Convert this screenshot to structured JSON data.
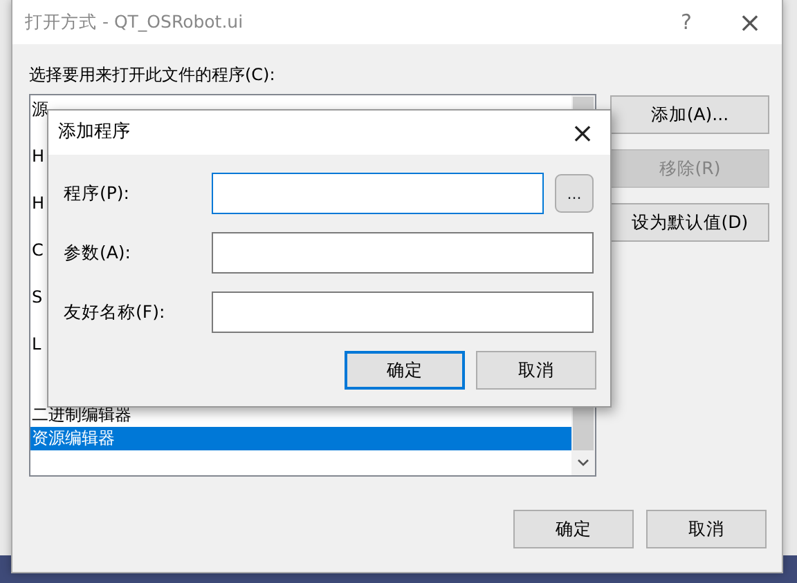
{
  "window": {
    "title": "打开方式 - QT_OSRobot.ui",
    "help": "?",
    "close": "×"
  },
  "prompt": "选择要用来打开此文件的程序(C):",
  "programs": [
    {
      "label": "源",
      "selected": false
    },
    {
      "selected": false
    },
    {
      "label": "H",
      "selected": false
    },
    {
      "selected": false
    },
    {
      "label": "H",
      "selected": false
    },
    {
      "selected": false
    },
    {
      "label": "C",
      "selected": false
    },
    {
      "selected": false
    },
    {
      "label": "S",
      "selected": false
    },
    {
      "selected": false
    },
    {
      "label": "L",
      "selected": false
    },
    {
      "selected": false
    },
    {
      "selected": false
    },
    {
      "label": "二进制编辑器",
      "selected": false
    },
    {
      "label": "资源编辑器",
      "selected": true
    }
  ],
  "side_buttons": [
    {
      "label": "添加(A)...",
      "disabled": false
    },
    {
      "label": "移除(R)",
      "disabled": true
    },
    {
      "label": "设为默认值(D)",
      "disabled": false
    }
  ],
  "buttons": [
    "确定",
    "取消"
  ],
  "add_dialog": {
    "title": "添加程序",
    "close": "×",
    "fields": [
      {
        "label": "程序(P):",
        "focused": true,
        "browse": "..."
      },
      {
        "label": "参数(A):",
        "focused": false
      },
      {
        "label": "友好名称(F):",
        "focused": false
      }
    ],
    "buttons": [
      {
        "label": "确定",
        "default": true
      },
      {
        "label": "取消",
        "default": false
      }
    ]
  }
}
